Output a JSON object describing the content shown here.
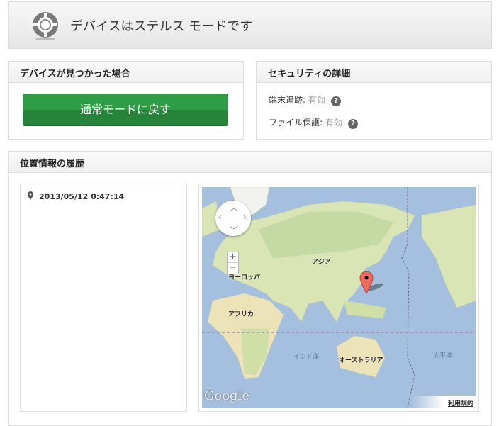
{
  "header": {
    "title": "デバイスはステルス モードです",
    "icon": "stealth-target-icon"
  },
  "found_panel": {
    "title": "デバイスが見つかった場合",
    "button_label": "通常モードに戻す",
    "button_color": "#2e9d45"
  },
  "security_panel": {
    "title": "セキュリティの詳細",
    "rows": [
      {
        "label": "端末追跡:",
        "value": "有効"
      },
      {
        "label": "ファイル保護:",
        "value": "有効"
      }
    ],
    "help": "?"
  },
  "history_panel": {
    "title": "位置情報の履歴",
    "entries": [
      {
        "timestamp": "2013/05/12 0:47:14"
      }
    ]
  },
  "map": {
    "labels": {
      "asia": "アジア",
      "europe": "ヨーロッパ",
      "africa": "アフリカ",
      "indian_ocean": "インド洋",
      "australia": "オーストラリア",
      "pacific": "太平洋"
    },
    "zoom_in": "+",
    "zoom_out": "−",
    "logo": "Google",
    "terms": "利用規約"
  }
}
